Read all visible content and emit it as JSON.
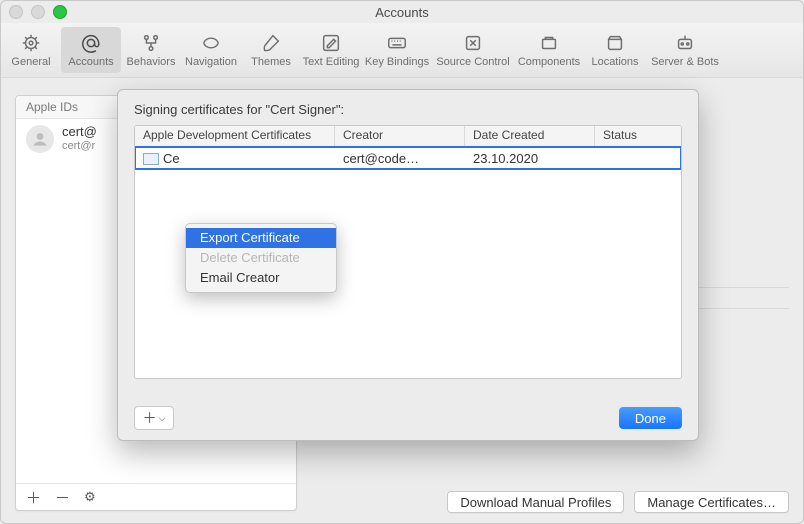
{
  "window": {
    "title": "Accounts"
  },
  "toolbar": {
    "items": [
      {
        "label": "General"
      },
      {
        "label": "Accounts"
      },
      {
        "label": "Behaviors"
      },
      {
        "label": "Navigation"
      },
      {
        "label": "Themes"
      },
      {
        "label": "Text Editing"
      },
      {
        "label": "Key Bindings"
      },
      {
        "label": "Source Control"
      },
      {
        "label": "Components"
      },
      {
        "label": "Locations"
      },
      {
        "label": "Server & Bots"
      }
    ]
  },
  "sidebar": {
    "header": "Apple IDs",
    "account": {
      "line1": "cert@",
      "line2": "cert@r"
    }
  },
  "buttons": {
    "download_profiles": "Download Manual Profiles",
    "manage_certs": "Manage Certificates…",
    "done": "Done"
  },
  "sheet": {
    "title": "Signing certificates for \"Cert Signer\":",
    "columns": {
      "c1": "Apple Development Certificates",
      "c2": "Creator",
      "c3": "Date Created",
      "c4": "Status"
    },
    "row": {
      "name_fragment": "Ce",
      "creator": "cert@code…",
      "date": "23.10.2020",
      "status": ""
    }
  },
  "context_menu": {
    "items": [
      {
        "label": "Export Certificate",
        "state": "highlighted"
      },
      {
        "label": "Delete Certificate",
        "state": "disabled"
      },
      {
        "label": "Email Creator",
        "state": "normal"
      }
    ]
  },
  "glyphs": {
    "plus": "＋",
    "minus": "－",
    "gear": "⚙",
    "chevron": "⌵"
  }
}
